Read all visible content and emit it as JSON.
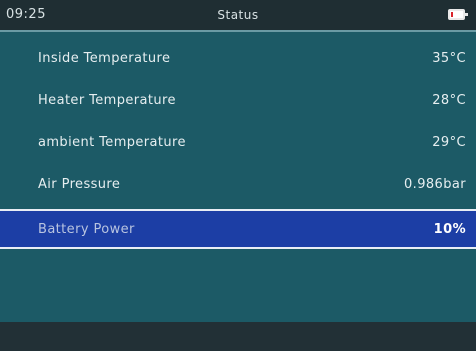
{
  "status_bar": {
    "time": "09:25",
    "title": "Status",
    "battery_icon": "battery-low-icon",
    "battery_level": 0.1
  },
  "rows": [
    {
      "label": "Inside Temperature",
      "value": "35°C"
    },
    {
      "label": "Heater Temperature",
      "value": "28°C"
    },
    {
      "label": "ambient Temperature",
      "value": "29°C"
    },
    {
      "label": "Air Pressure",
      "value": "0.986bar"
    },
    {
      "label": "Battery Power",
      "value": "10%"
    }
  ],
  "colors": {
    "background": "#1c5a66",
    "status_bar": "#1f2e33",
    "selection": "#1c3ea5",
    "battery_low": "#d9232b"
  }
}
